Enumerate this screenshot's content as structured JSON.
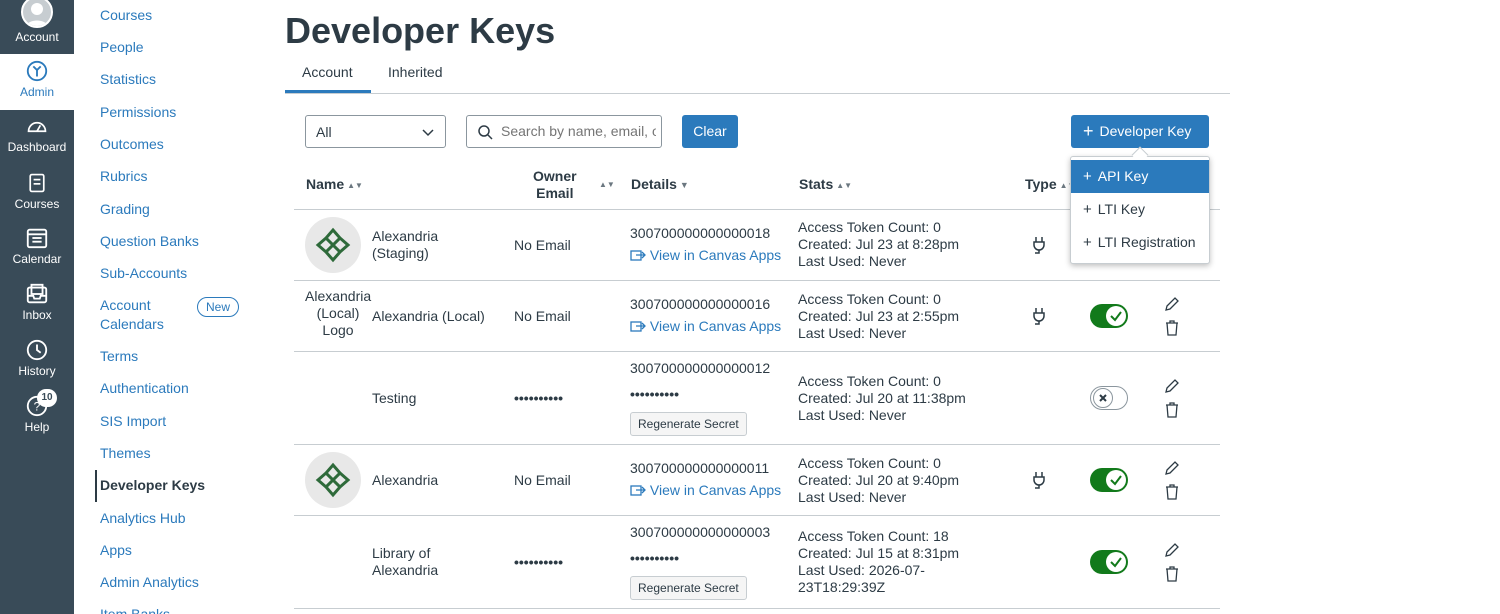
{
  "global_nav": {
    "account": "Account",
    "admin": "Admin",
    "dashboard": "Dashboard",
    "courses": "Courses",
    "calendar": "Calendar",
    "inbox": "Inbox",
    "history": "History",
    "help": "Help",
    "help_badge": "10",
    "active_color": "#2b7abc",
    "bg_color": "#394b58"
  },
  "sub_nav": {
    "items": [
      "Courses",
      "People",
      "Statistics",
      "Permissions",
      "Outcomes",
      "Rubrics",
      "Grading",
      "Question Banks",
      "Sub-Accounts",
      "Account Calendars",
      "Terms",
      "Authentication",
      "SIS Import",
      "Themes",
      "Developer Keys",
      "Analytics Hub",
      "Apps",
      "Admin Analytics",
      "Item Banks"
    ],
    "account_calendars_line1": "Account",
    "account_calendars_line2": "Calendars",
    "new_badge": "New",
    "active": "Developer Keys"
  },
  "page": {
    "title": "Developer Keys",
    "tabs": [
      "Account",
      "Inherited"
    ],
    "filter_value": "All",
    "search_placeholder": "Search by name, email, or ID",
    "clear_label": "Clear",
    "add_button_label": "Developer Key",
    "menu_items": [
      "API Key",
      "LTI Key",
      "LTI Registration"
    ]
  },
  "table": {
    "headers": {
      "name": "Name",
      "owner_line1": "Owner",
      "owner_line2": "Email",
      "details": "Details",
      "stats": "Stats",
      "type": "Type"
    },
    "view_link": "View in Canvas Apps",
    "regen_label": "Regenerate Secret",
    "rows": [
      {
        "name1": "Alexandria",
        "name2": "(Staging)",
        "email": "No Email",
        "id": "300700000000000018",
        "stat1": "Access Token Count: 0",
        "stat2": "Created: Jul 23 at 8:28pm",
        "stat3": "Last Used: Never"
      },
      {
        "name1": "Alexandria (Local)",
        "alt1": "Alexandria",
        "alt2": "(Local)",
        "alt3": "Logo",
        "email": "No Email",
        "id": "300700000000000016",
        "stat1": "Access Token Count: 0",
        "stat2": "Created: Jul 23 at 2:55pm",
        "stat3": "Last Used: Never",
        "state": "on"
      },
      {
        "name1": "Testing",
        "email": "••••••••••",
        "id": "300700000000000012",
        "secret": "••••••••••",
        "stat1": "Access Token Count: 0",
        "stat2": "Created: Jul 20 at 11:38pm",
        "stat3": "Last Used: Never",
        "state": "off"
      },
      {
        "name1": "Alexandria",
        "email": "No Email",
        "id": "300700000000000011",
        "stat1": "Access Token Count: 0",
        "stat2": "Created: Jul 20 at 9:40pm",
        "stat3": "Last Used: Never",
        "state": "on"
      },
      {
        "name1": "Library of",
        "name2": "Alexandria",
        "email": "••••••••••",
        "id": "300700000000000003",
        "secret": "••••••••••",
        "stat1": "Access Token Count: 18",
        "stat2": "Created: Jul 15 at 8:31pm",
        "stat3": "Last Used: 2026-07-",
        "stat4": "23T18:29:39Z",
        "state": "on"
      }
    ]
  }
}
